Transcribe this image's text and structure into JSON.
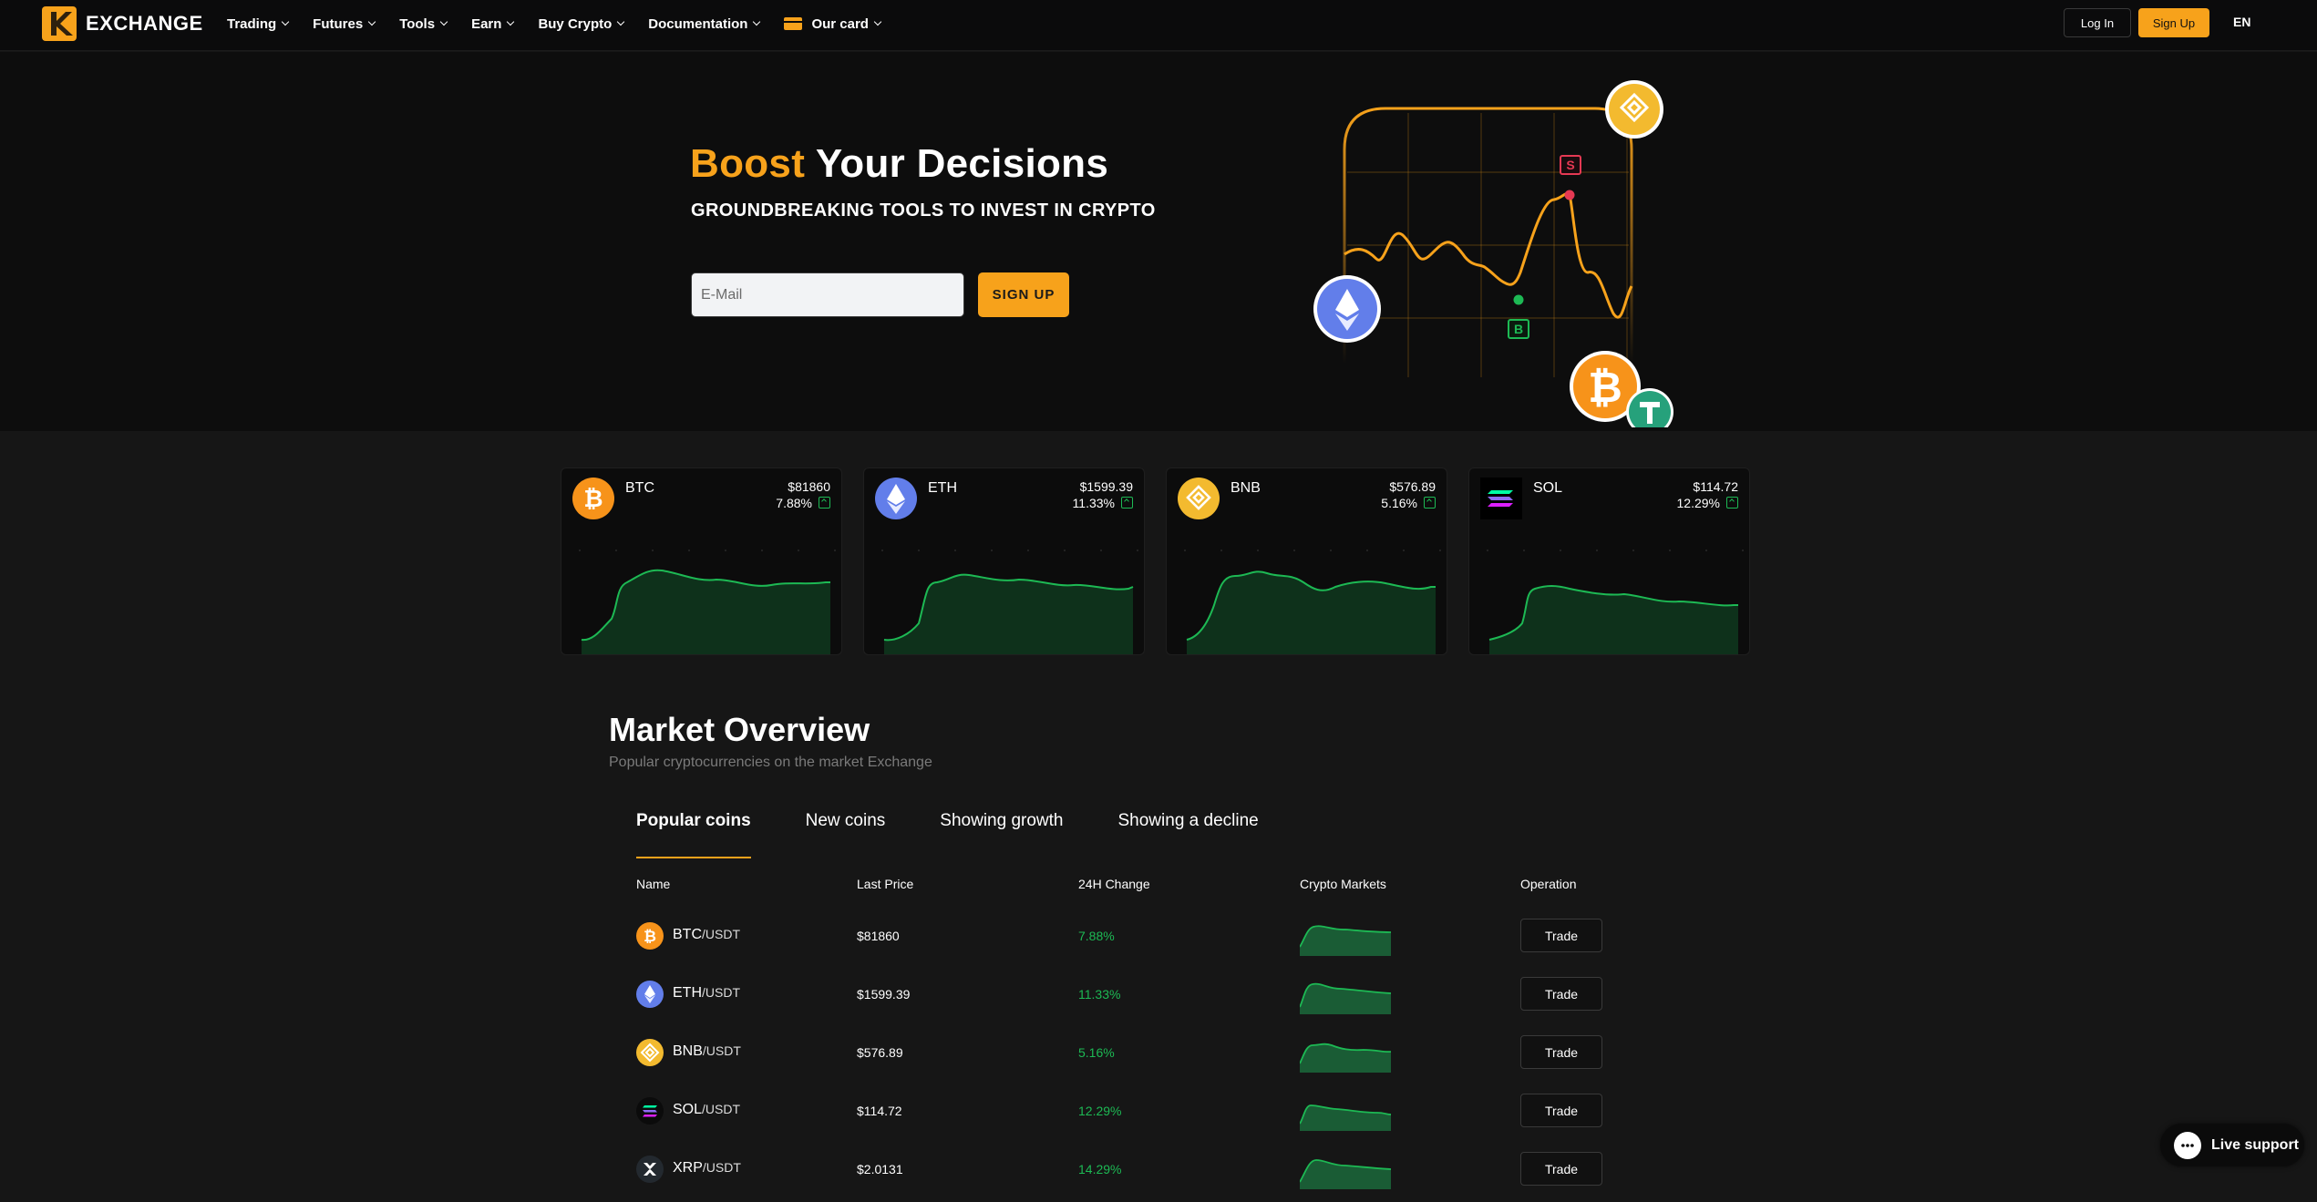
{
  "brand": {
    "name": "EXCHANGE"
  },
  "nav": {
    "items": [
      {
        "label": "Trading"
      },
      {
        "label": "Futures"
      },
      {
        "label": "Tools"
      },
      {
        "label": "Earn"
      },
      {
        "label": "Buy Crypto"
      },
      {
        "label": "Documentation"
      },
      {
        "label": "Our card",
        "icon": "card-icon"
      }
    ],
    "login": "Log In",
    "signup": "Sign Up",
    "lang": "EN"
  },
  "hero": {
    "title_accent": "Boost",
    "title_rest": " Your Decisions",
    "subtitle": "GROUNDBREAKING TOOLS TO INVEST IN CRYPTO",
    "email_placeholder": "E-Mail",
    "signup": "SIGN UP",
    "chart_markers": {
      "sell": "S",
      "buy": "B"
    }
  },
  "cards": [
    {
      "symbol": "BTC",
      "price": "$81860",
      "change": "7.88%",
      "icon": "bitcoin-icon",
      "color": "#f7931a"
    },
    {
      "symbol": "ETH",
      "price": "$1599.39",
      "change": "11.33%",
      "icon": "ethereum-icon",
      "color": "#627eea"
    },
    {
      "symbol": "BNB",
      "price": "$576.89",
      "change": "5.16%",
      "icon": "bnb-icon",
      "color": "#f3ba2f"
    },
    {
      "symbol": "SOL",
      "price": "$114.72",
      "change": "12.29%",
      "icon": "solana-icon",
      "color": "#000000"
    }
  ],
  "market": {
    "title": "Market Overview",
    "subtitle": "Popular cryptocurrencies on the market Exchange",
    "tabs": [
      "Popular coins",
      "New coins",
      "Showing growth",
      "Showing a decline"
    ],
    "columns": [
      "Name",
      "Last Price",
      "24H Change",
      "Crypto Markets",
      "Operation"
    ],
    "rows": [
      {
        "base": "BTC",
        "quote": "/USDT",
        "price": "$81860",
        "change": "7.88%",
        "action": "Trade",
        "icon": "bitcoin-icon"
      },
      {
        "base": "ETH",
        "quote": "/USDT",
        "price": "$1599.39",
        "change": "11.33%",
        "action": "Trade",
        "icon": "ethereum-icon"
      },
      {
        "base": "BNB",
        "quote": "/USDT",
        "price": "$576.89",
        "change": "5.16%",
        "action": "Trade",
        "icon": "bnb-icon"
      },
      {
        "base": "SOL",
        "quote": "/USDT",
        "price": "$114.72",
        "change": "12.29%",
        "action": "Trade",
        "icon": "solana-icon"
      },
      {
        "base": "XRP",
        "quote": "/USDT",
        "price": "$2.0131",
        "change": "14.29%",
        "action": "Trade",
        "icon": "xrp-icon"
      }
    ]
  },
  "support": {
    "label": "Live support"
  },
  "colors": {
    "accent": "#f7a21b",
    "positive": "#1db954",
    "background": "#161616"
  }
}
